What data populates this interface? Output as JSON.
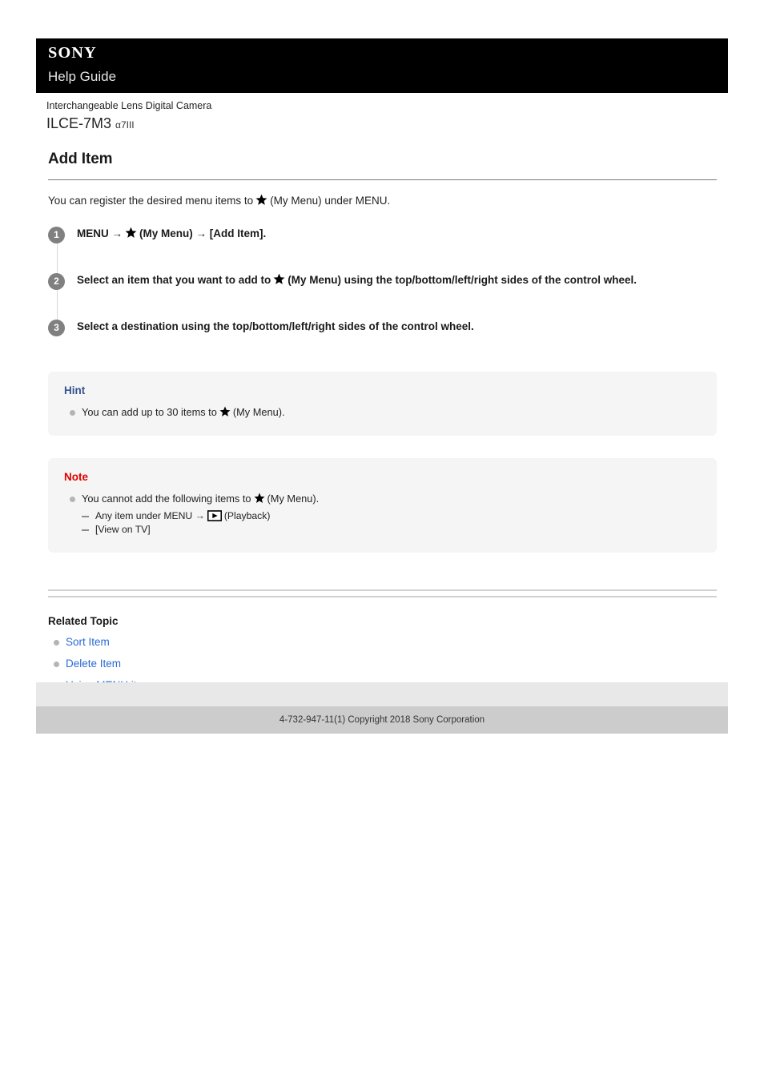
{
  "header": {
    "logo": "SONY",
    "subtitle": "Help Guide"
  },
  "product": {
    "category": "Interchangeable Lens Digital Camera",
    "model": "ILCE-7M3",
    "alias": "α7III"
  },
  "article": {
    "title": "Add Item",
    "intro_before_star": "You can register the desired menu items to",
    "intro_after_star": "(My Menu) under MENU.",
    "steps": [
      {
        "number": "1",
        "before_star": "MENU →",
        "after_star": "(My Menu) → [Add Item]."
      },
      {
        "number": "2",
        "before_star": "Select an item that you want to add to",
        "after_star": "(My Menu) using the top/bottom/left/right sides of the control wheel."
      },
      {
        "number": "3",
        "before_star": "Select a destination using the top/bottom/left/right sides of the control wheel.",
        "after_star": ""
      }
    ]
  },
  "hint": {
    "title": "Hint",
    "item_before_star": "You can add up to 30 items to",
    "item_after_star": "(My Menu)."
  },
  "note": {
    "title": "Note",
    "item_before_star": "You cannot add the following items to",
    "item_after_star": "(My Menu).",
    "sub_items": [
      {
        "before_icon": "Any item under MENU →",
        "after_icon": "(Playback)"
      },
      {
        "before_icon": "[View on TV]",
        "after_icon": ""
      }
    ]
  },
  "related": {
    "title": "Related Topic",
    "links": [
      {
        "label": "Sort Item"
      },
      {
        "label": "Delete Item"
      },
      {
        "label": "Using MENU items"
      }
    ]
  },
  "footer": {
    "copyright": "4-732-947-11(1) Copyright 2018 Sony Corporation"
  },
  "colors": {
    "header_bg": "#000000",
    "hint_title": "#36538f",
    "note_title": "#e00000",
    "link": "#2a6ad4",
    "badge": "#808080",
    "callout_bg": "#f5f5f5",
    "footer_bar": "#cccccc"
  }
}
